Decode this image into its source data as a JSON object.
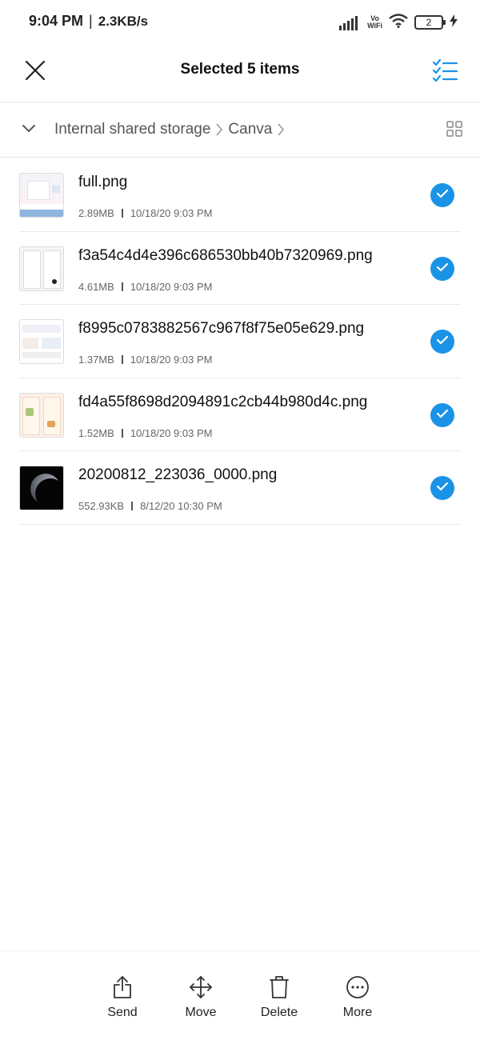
{
  "status_bar": {
    "time": "9:04 PM",
    "separator": "|",
    "net_speed": "2.3KB/s",
    "vowifi_top": "Vo",
    "vowifi_bottom": "WiFi",
    "battery_level": "2"
  },
  "header": {
    "title": "Selected 5 items"
  },
  "breadcrumb": {
    "items": [
      "Internal shared storage",
      "Canva"
    ]
  },
  "files": [
    {
      "name": "full.png",
      "size": "2.89MB",
      "date": "10/18/20 9:03 PM",
      "selected": true
    },
    {
      "name": "f3a54c4d4e396c686530bb40b7320969.png",
      "size": "4.61MB",
      "date": "10/18/20 9:03 PM",
      "selected": true
    },
    {
      "name": "f8995c0783882567c967f8f75e05e629.png",
      "size": "1.37MB",
      "date": "10/18/20 9:03 PM",
      "selected": true
    },
    {
      "name": "fd4a55f8698d2094891c2cb44b980d4c.png",
      "size": "1.52MB",
      "date": "10/18/20 9:03 PM",
      "selected": true
    },
    {
      "name": "20200812_223036_0000.png",
      "size": "552.93KB",
      "date": "8/12/20 10:30 PM",
      "selected": true
    }
  ],
  "actions": {
    "send": "Send",
    "move": "Move",
    "delete": "Delete",
    "more": "More"
  },
  "colors": {
    "accent": "#1a93e6"
  }
}
